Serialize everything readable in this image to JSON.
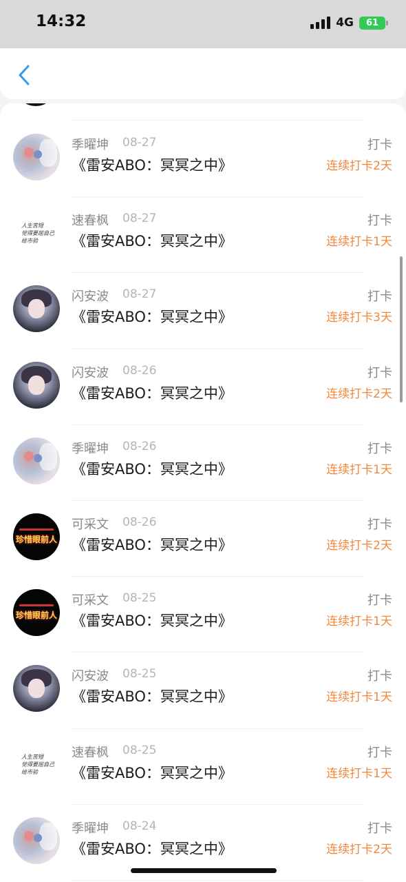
{
  "status_bar": {
    "time": "14:32",
    "network": "4G",
    "battery": "61"
  },
  "navbar": {
    "back_icon": "chevron-left-icon",
    "accent": "#2e9bf0"
  },
  "colors": {
    "streak": "#f0883e",
    "name": "#8a8a8a",
    "date": "#b5b5b5"
  },
  "items": [
    {
      "name": "季曜坤",
      "date": "08-27",
      "book": "《雷安ABO：冥冥之中》",
      "type": "打卡",
      "streak": "连续打卡2天",
      "avatar": "photo"
    },
    {
      "name": "速春枫",
      "date": "08-27",
      "book": "《雷安ABO：冥冥之中》",
      "type": "打卡",
      "streak": "连续打卡1天",
      "avatar": "text"
    },
    {
      "name": "闪安波",
      "date": "08-27",
      "book": "《雷安ABO：冥冥之中》",
      "type": "打卡",
      "streak": "连续打卡3天",
      "avatar": "anime"
    },
    {
      "name": "闪安波",
      "date": "08-26",
      "book": "《雷安ABO：冥冥之中》",
      "type": "打卡",
      "streak": "连续打卡2天",
      "avatar": "anime"
    },
    {
      "name": "季曜坤",
      "date": "08-26",
      "book": "《雷安ABO：冥冥之中》",
      "type": "打卡",
      "streak": "连续打卡1天",
      "avatar": "photo"
    },
    {
      "name": "可采文",
      "date": "08-26",
      "book": "《雷安ABO：冥冥之中》",
      "type": "打卡",
      "streak": "连续打卡2天",
      "avatar": "black"
    },
    {
      "name": "可采文",
      "date": "08-25",
      "book": "《雷安ABO：冥冥之中》",
      "type": "打卡",
      "streak": "连续打卡1天",
      "avatar": "black"
    },
    {
      "name": "闪安波",
      "date": "08-25",
      "book": "《雷安ABO：冥冥之中》",
      "type": "打卡",
      "streak": "连续打卡1天",
      "avatar": "anime"
    },
    {
      "name": "速春枫",
      "date": "08-25",
      "book": "《雷安ABO：冥冥之中》",
      "type": "打卡",
      "streak": "连续打卡1天",
      "avatar": "text"
    },
    {
      "name": "季曜坤",
      "date": "08-24",
      "book": "《雷安ABO：冥冥之中》",
      "type": "打卡",
      "streak": "连续打卡2天",
      "avatar": "photo"
    }
  ],
  "avatar_text_lines": [
    "人生苦短",
    "觉得要屈自己",
    "给市验"
  ],
  "avatar_black_text": "珍惜眼前人"
}
